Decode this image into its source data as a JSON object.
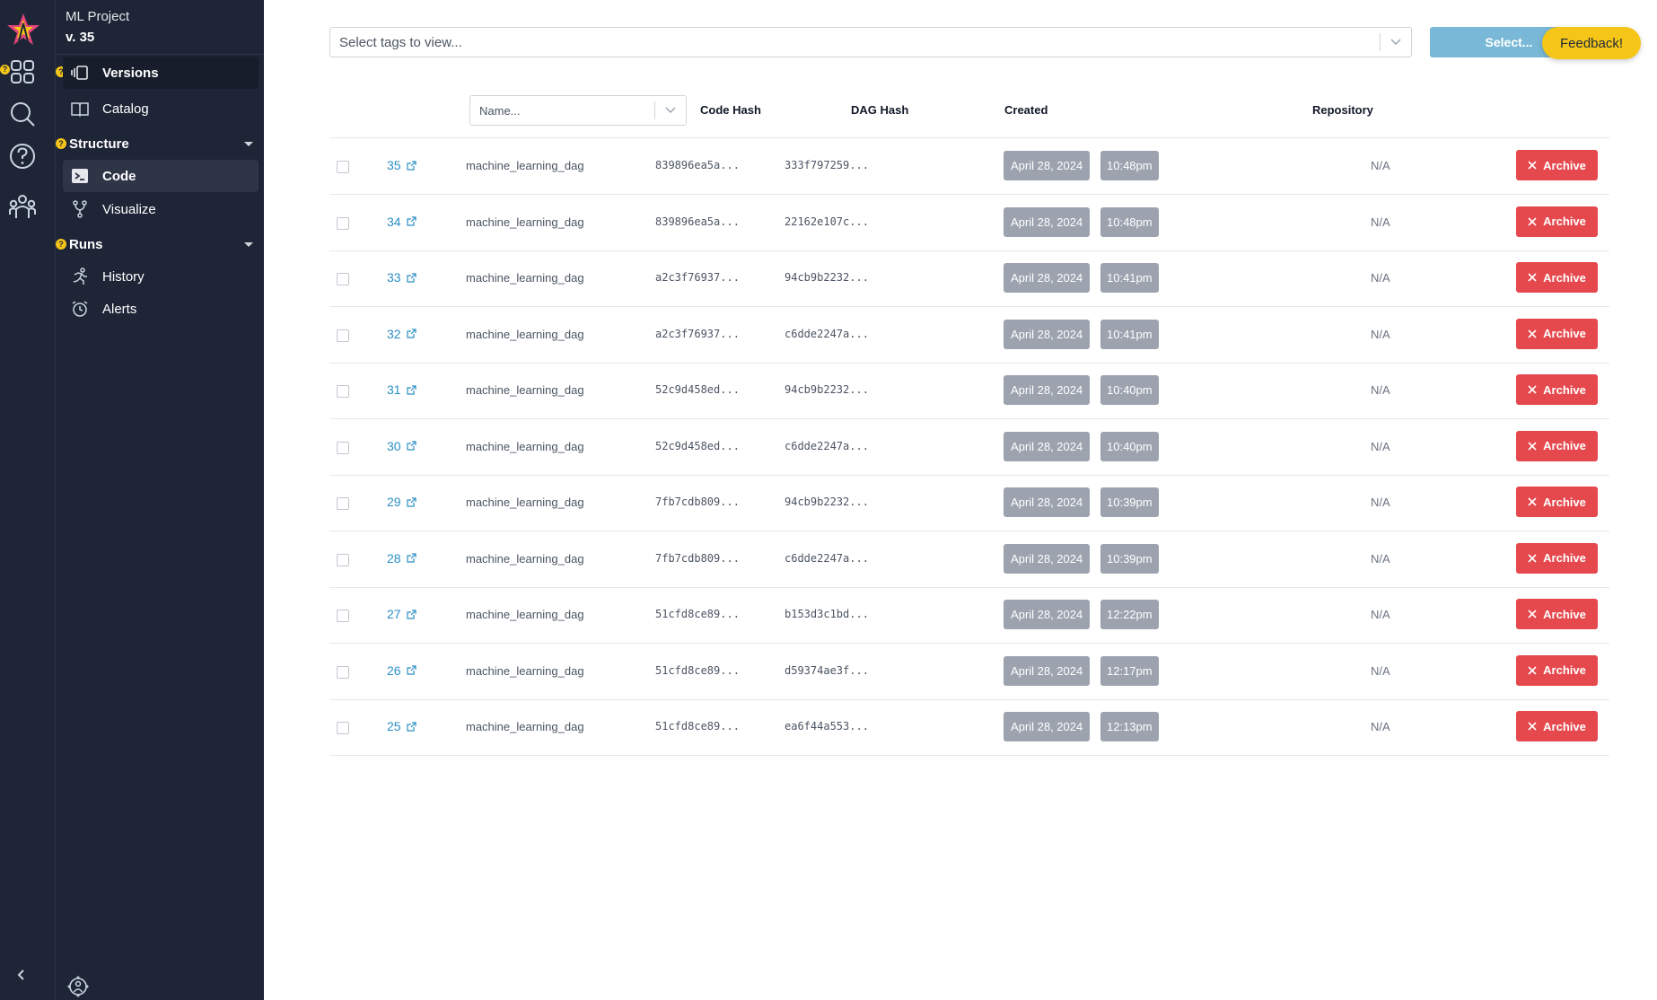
{
  "project": {
    "name": "ML Project",
    "version": "v. 35"
  },
  "sidebar": {
    "items": [
      {
        "label": "Versions",
        "icon": "versions-icon"
      },
      {
        "label": "Catalog",
        "icon": "book-icon"
      }
    ],
    "sections": [
      {
        "title": "Structure",
        "items": [
          {
            "label": "Code",
            "icon": "terminal-icon"
          },
          {
            "label": "Visualize",
            "icon": "branch-icon"
          }
        ]
      },
      {
        "title": "Runs",
        "items": [
          {
            "label": "History",
            "icon": "running-icon"
          },
          {
            "label": "Alerts",
            "icon": "alarm-icon"
          }
        ]
      }
    ]
  },
  "toolbar": {
    "tags_placeholder": "Select tags to view...",
    "select_label": "Select...",
    "feedback_label": "Feedback!"
  },
  "table": {
    "name_placeholder": "Name...",
    "columns": {
      "code_hash": "Code Hash",
      "dag_hash": "DAG Hash",
      "created": "Created",
      "repository": "Repository"
    },
    "archive_label": "Archive",
    "rows": [
      {
        "version": "35",
        "dag": "machine_learning_dag",
        "code_hash": "839896ea5a...",
        "dag_hash": "333f797259...",
        "date": "April 28, 2024",
        "time": "10:48pm",
        "repo": "N/A"
      },
      {
        "version": "34",
        "dag": "machine_learning_dag",
        "code_hash": "839896ea5a...",
        "dag_hash": "22162e107c...",
        "date": "April 28, 2024",
        "time": "10:48pm",
        "repo": "N/A"
      },
      {
        "version": "33",
        "dag": "machine_learning_dag",
        "code_hash": "a2c3f76937...",
        "dag_hash": "94cb9b2232...",
        "date": "April 28, 2024",
        "time": "10:41pm",
        "repo": "N/A"
      },
      {
        "version": "32",
        "dag": "machine_learning_dag",
        "code_hash": "a2c3f76937...",
        "dag_hash": "c6dde2247a...",
        "date": "April 28, 2024",
        "time": "10:41pm",
        "repo": "N/A"
      },
      {
        "version": "31",
        "dag": "machine_learning_dag",
        "code_hash": "52c9d458ed...",
        "dag_hash": "94cb9b2232...",
        "date": "April 28, 2024",
        "time": "10:40pm",
        "repo": "N/A"
      },
      {
        "version": "30",
        "dag": "machine_learning_dag",
        "code_hash": "52c9d458ed...",
        "dag_hash": "c6dde2247a...",
        "date": "April 28, 2024",
        "time": "10:40pm",
        "repo": "N/A"
      },
      {
        "version": "29",
        "dag": "machine_learning_dag",
        "code_hash": "7fb7cdb809...",
        "dag_hash": "94cb9b2232...",
        "date": "April 28, 2024",
        "time": "10:39pm",
        "repo": "N/A"
      },
      {
        "version": "28",
        "dag": "machine_learning_dag",
        "code_hash": "7fb7cdb809...",
        "dag_hash": "c6dde2247a...",
        "date": "April 28, 2024",
        "time": "10:39pm",
        "repo": "N/A"
      },
      {
        "version": "27",
        "dag": "machine_learning_dag",
        "code_hash": "51cfd8ce89...",
        "dag_hash": "b153d3c1bd...",
        "date": "April 28, 2024",
        "time": "12:22pm",
        "repo": "N/A"
      },
      {
        "version": "26",
        "dag": "machine_learning_dag",
        "code_hash": "51cfd8ce89...",
        "dag_hash": "d59374ae3f...",
        "date": "April 28, 2024",
        "time": "12:17pm",
        "repo": "N/A"
      },
      {
        "version": "25",
        "dag": "machine_learning_dag",
        "code_hash": "51cfd8ce89...",
        "dag_hash": "ea6f44a553...",
        "date": "April 28, 2024",
        "time": "12:13pm",
        "repo": "N/A"
      }
    ]
  },
  "colors": {
    "sidebar_bg": "#1e2536",
    "link": "#2b8fc4",
    "archive": "#e5484d",
    "badge": "#f5c518",
    "select_button": "#79b8d6"
  }
}
